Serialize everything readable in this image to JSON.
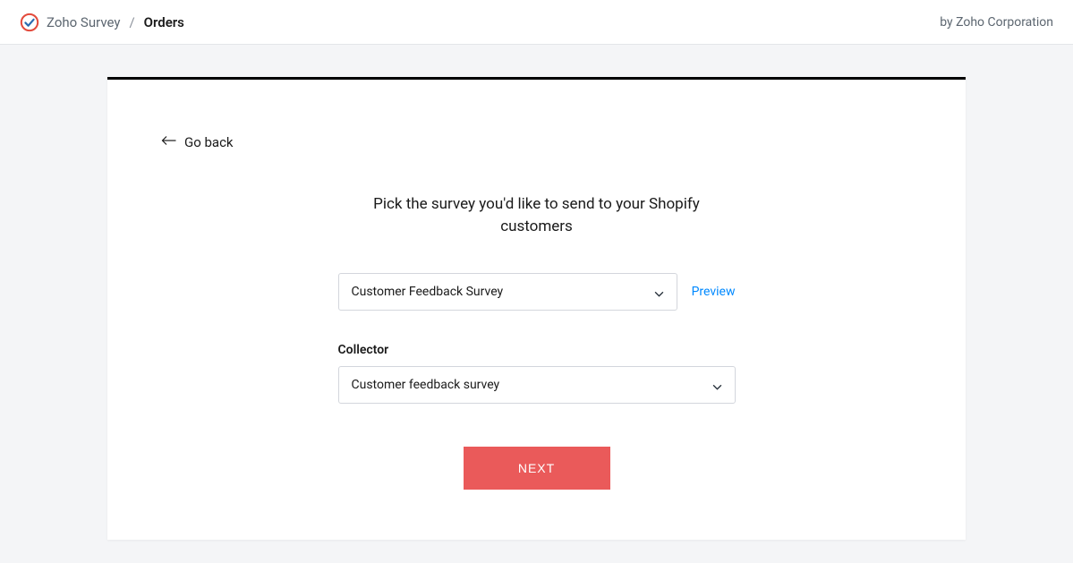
{
  "header": {
    "app_name": "Zoho Survey",
    "separator": "/",
    "page_name": "Orders",
    "byline": "by Zoho Corporation"
  },
  "card": {
    "go_back": "Go back",
    "heading": "Pick the survey you'd like to send to your Shopify customers",
    "survey_select": {
      "value": "Customer Feedback Survey"
    },
    "preview_link": "Preview",
    "collector_label": "Collector",
    "collector_select": {
      "value": "Customer feedback survey"
    },
    "next_button": "NEXT"
  }
}
